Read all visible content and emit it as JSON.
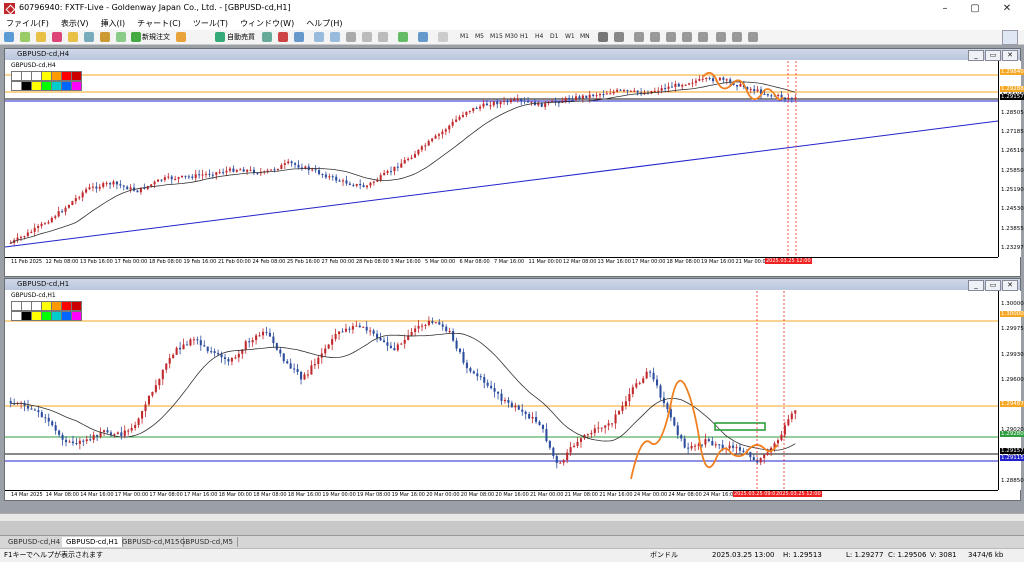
{
  "window": {
    "title": "60796940: FXTF-Live - Goldenway Japan Co., Ltd. - [GBPUSD-cd,H1]"
  },
  "menu": [
    "ファイル(F)",
    "表示(V)",
    "挿入(I)",
    "チャート(C)",
    "ツール(T)",
    "ウィンドウ(W)",
    "ヘルプ(H)"
  ],
  "toolbar": {
    "new_order": "新規注文",
    "auto_trade": "自動売買",
    "timeframes": [
      "M1",
      "M5",
      "M15",
      "M30",
      "H1",
      "H4",
      "D1",
      "W1",
      "MN"
    ]
  },
  "charts": [
    {
      "window_title": "GBPUSD-cd,H4",
      "plot_title": "GBPUSD-cd,H4",
      "y_labels": [
        "1.29840",
        "1.29105",
        "1.28505",
        "1.27185",
        "1.26510",
        "1.25850",
        "1.25190",
        "1.24530",
        "1.23855",
        "1.23297"
      ],
      "y_tags": [
        {
          "text": "1.29840",
          "color": "#f5a623"
        },
        {
          "text": "1.29288",
          "color": "#f5a623"
        },
        {
          "text": "1.29157",
          "color": "#000000"
        }
      ],
      "x_labels": [
        "11 Feb 2025",
        "12 Feb 08:00",
        "13 Feb 16:00",
        "17 Feb 00:00",
        "18 Feb 08:00",
        "19 Feb 16:00",
        "21 Feb 00:00",
        "24 Feb 08:00",
        "25 Feb 16:00",
        "27 Feb 00:00",
        "28 Feb 08:00",
        "3 Mar 16:00",
        "5 Mar 00:00",
        "6 Mar 08:00",
        "7 Mar 16:00",
        "11 Mar 00:00",
        "12 Mar 08:00",
        "13 Mar 16:00",
        "17 Mar 00:00",
        "18 Mar 08:00",
        "19 Mar 16:00",
        "21 Mar 00:00"
      ],
      "x_tags": [
        "2025.03.25 12:00"
      ]
    },
    {
      "window_title": "GBPUSD-cd,H1",
      "plot_title": "GBPUSD-cd,H1",
      "y_labels": [
        "1.30000",
        "1.29975",
        "1.29930",
        "1.29600",
        "1.29350",
        "1.29020",
        "1.28975",
        "1.28850"
      ],
      "y_tags": [
        {
          "text": "1.30000",
          "color": "#f5a623"
        },
        {
          "text": "1.29487",
          "color": "#f5a623"
        },
        {
          "text": "1.29280",
          "color": "#2e9e3e"
        },
        {
          "text": "1.29157",
          "color": "#000000"
        },
        {
          "text": "1.29115",
          "color": "#2222cc"
        }
      ],
      "x_labels": [
        "14 Mar 2025",
        "14 Mar 08:00",
        "14 Mar 16:00",
        "17 Mar 00:00",
        "17 Mar 08:00",
        "17 Mar 16:00",
        "18 Mar 00:00",
        "18 Mar 08:00",
        "18 Mar 16:00",
        "19 Mar 00:00",
        "19 Mar 08:00",
        "19 Mar 16:00",
        "20 Mar 00:00",
        "20 Mar 08:00",
        "20 Mar 16:00",
        "21 Mar 00:00",
        "21 Mar 08:00",
        "21 Mar 16:00",
        "24 Mar 00:00",
        "24 Mar 08:00",
        "24 Mar 16:00"
      ],
      "x_tags": [
        "2025.03.25 09:00",
        "2025.03.25 12:00"
      ]
    }
  ],
  "tabs": [
    "GBPUSD-cd,H4",
    "GBPUSD-cd,H1",
    "GBPUSD-cd,M15",
    "GBPUSD-cd,M5"
  ],
  "status": {
    "help": "F1キーでヘルプが表示されます",
    "profile": "ボンドル",
    "datetime": "2025.03.25 13:00",
    "open": "H: 1.29513",
    "low": "L: 1.29277",
    "close": "C: 1.29506",
    "vol": "V: 3081",
    "net": "3474/6 kb"
  }
}
